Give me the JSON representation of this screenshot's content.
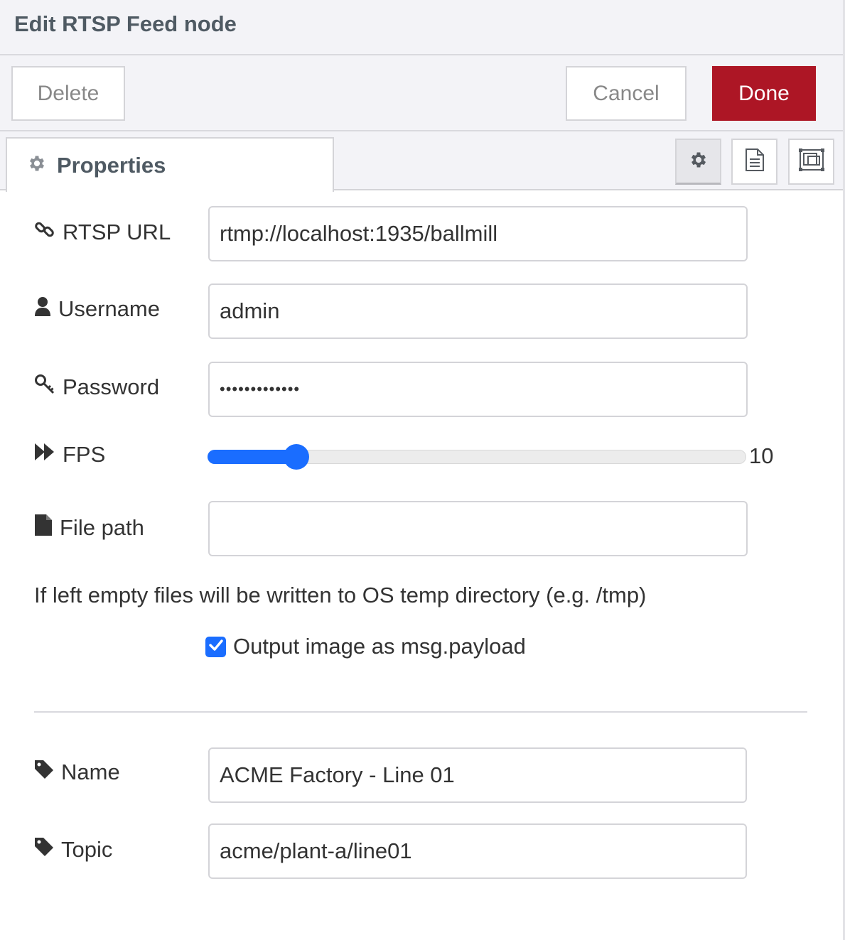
{
  "dialog": {
    "title": "Edit RTSP Feed node"
  },
  "buttons": {
    "delete": "Delete",
    "cancel": "Cancel",
    "done": "Done"
  },
  "tabs": {
    "properties": {
      "label": "Properties",
      "icon": "gear-icon"
    },
    "side_icons": [
      "gear-icon",
      "description-icon",
      "appearance-icon"
    ]
  },
  "fields": {
    "rtsp_url": {
      "label": "RTSP URL",
      "value": "rtmp://localhost:1935/ballmill",
      "icon": "link-icon"
    },
    "username": {
      "label": "Username",
      "value": "admin",
      "icon": "user-icon"
    },
    "password": {
      "label": "Password",
      "value": "•••••••••••••",
      "icon": "key-icon"
    },
    "fps": {
      "label": "FPS",
      "value": "10",
      "fraction": 0.165,
      "icon": "fast-forward-icon"
    },
    "file_path": {
      "label": "File path",
      "value": "",
      "icon": "file-icon"
    },
    "name": {
      "label": "Name",
      "value": "ACME Factory - Line 01",
      "icon": "tag-icon"
    },
    "topic": {
      "label": "Topic",
      "value": "acme/plant-a/line01",
      "icon": "tag-icon"
    }
  },
  "hint": "If left empty files will be written to OS temp directory (e.g. /tmp)",
  "output_checkbox": {
    "label": "Output image as msg.payload",
    "checked": true
  },
  "colors": {
    "primary": "#ad1625",
    "accent": "#1a6dff",
    "heading": "#4f5a63"
  }
}
